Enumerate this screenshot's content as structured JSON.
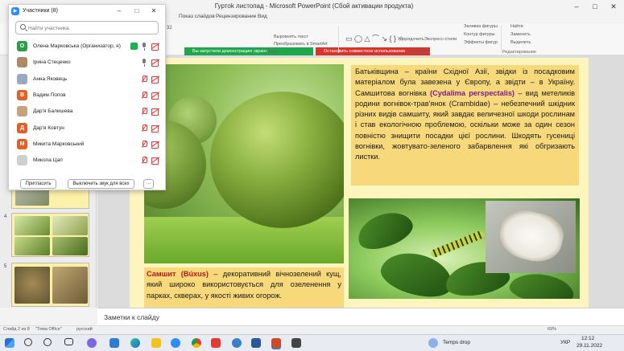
{
  "window": {
    "title": "Гуртok листопад  -  Microsoft PowerPoint (Сбой активации продукта)",
    "controls": [
      "–",
      "□",
      "✕"
    ]
  },
  "ribbon": {
    "tabs": [
      "Показ слайдов",
      "Рецензирование",
      "Вид"
    ],
    "font_size": "32",
    "share_active": "Вы запустили демонстрацию экрана",
    "share_stop": "Остановить совместное использование",
    "paragraph_items": [
      "Направление текста",
      "Выровнять текст",
      "Преобразовать в SmartArt"
    ],
    "paragraph_group": "Абзац",
    "drawing_items": [
      "Упорядочить",
      "Экспресс-стили",
      "Заливка фигуры",
      "Контур фигуры",
      "Эффекты фигур"
    ],
    "drawing_group": "Рисование",
    "editing_items": [
      "Найти",
      "Заменить",
      "Выделить"
    ],
    "editing_group": "Редактирование"
  },
  "participants": {
    "title": "Участники (8)",
    "search_placeholder": "Найти участника",
    "people": [
      {
        "name": "Олена Марковська (Организатор, я)",
        "initial": "О",
        "color": "#2e9e46",
        "mic": "on",
        "sharing": true
      },
      {
        "name": "Ірина Стеценко",
        "initial": "",
        "color": "#b08a66",
        "mic": "on",
        "sharing": false
      },
      {
        "name": "Анна Яковець",
        "initial": "",
        "color": "#9aa8c4",
        "mic": "off",
        "sharing": false
      },
      {
        "name": "Вадим Попов",
        "initial": "В",
        "color": "#e0602a",
        "mic": "off",
        "sharing": false
      },
      {
        "name": "Дар'я Балишева",
        "initial": "",
        "color": "#c8a07a",
        "mic": "off",
        "sharing": false
      },
      {
        "name": "Дар'я Ковтун",
        "initial": "Д",
        "color": "#e0602a",
        "mic": "off",
        "sharing": false
      },
      {
        "name": "Микита Марковський",
        "initial": "М",
        "color": "#e0602a",
        "mic": "off",
        "sharing": false
      },
      {
        "name": "Микола Цап",
        "initial": "",
        "color": "#cfcfcf",
        "mic": "off",
        "sharing": false
      }
    ],
    "invite_label": "Пригласить",
    "mute_all_label": "Выключить звук для всех",
    "more_label": "···"
  },
  "thumbnails": {
    "numbers": [
      "4",
      "5",
      "6"
    ]
  },
  "slide": {
    "right_text_start": "Батьківщина – країни Східної Азії, звідки із посадковим матеріалом була завезена у Європу, а звідти – в Україну. Самшитова вогнівка ",
    "right_text_species": "(Cydalima perspectalis)",
    "right_text_end": " – вид метеликів родини вогнівок-трав'янок (Crambidae) – небезпечний шкідник різних видів самшиту, який завдає величезної шкоди рослинам і став екологічною проблемою, оскільки може за один сезон повністю знищити посадки цієї рослини. Шкодять гусениці вогнівки, жовтувато-зеленого забарвлення які обгризають листки.",
    "left_term": "Самшит (Búxus)",
    "left_text": " – декоративний вічнозелений кущ, який широко використовується для озеленення у парках, скверах, у якості живих огорож."
  },
  "notes": {
    "placeholder": "Заметки к слайду"
  },
  "statusbar": {
    "slide_info": "Слайд 2 из 8",
    "theme": "\"Тема Office\"",
    "language": "русский",
    "zoom": "69%"
  },
  "taskbar": {
    "weather": "Temps drop",
    "language": "УКР",
    "time": "12:12",
    "date": "29.11.2022"
  },
  "colors": {
    "slide_bg": "#fcf5be",
    "text_box": "#f7d87a",
    "share_green": "#1fa84b",
    "share_red": "#d9342b"
  }
}
